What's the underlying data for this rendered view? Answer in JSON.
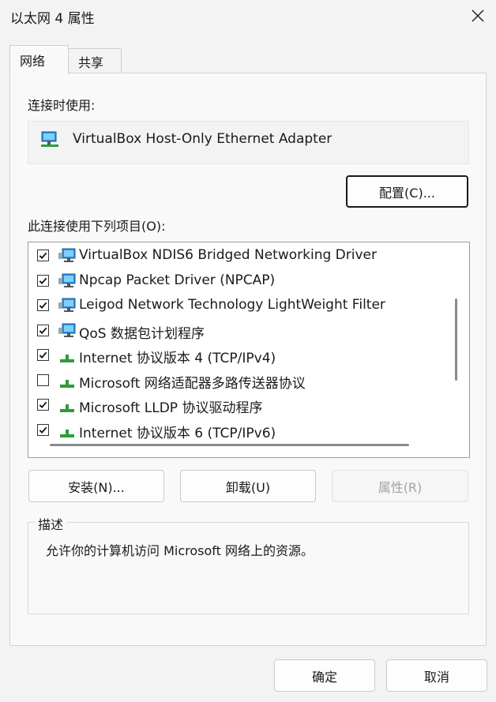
{
  "window": {
    "title": "以太网 4 属性"
  },
  "tabs": [
    {
      "label": "网络",
      "active": true
    },
    {
      "label": "共享",
      "active": false
    }
  ],
  "connect_using": {
    "label": "连接时使用:",
    "adapter": "VirtualBox Host-Only Ethernet Adapter",
    "icon": "network-adapter-icon"
  },
  "configure_button": "配置(C)...",
  "items_section": {
    "label": "此连接使用下列项目(O):",
    "items": [
      {
        "label": "VirtualBox NDIS6 Bridged Networking Driver",
        "checked": true,
        "icon": "network-service-icon"
      },
      {
        "label": "Npcap Packet Driver (NPCAP)",
        "checked": true,
        "icon": "network-service-icon"
      },
      {
        "label": "Leigod Network Technology LightWeight Filter",
        "checked": true,
        "icon": "network-service-icon"
      },
      {
        "label": "QoS 数据包计划程序",
        "checked": true,
        "icon": "network-service-icon"
      },
      {
        "label": "Internet 协议版本 4 (TCP/IPv4)",
        "checked": true,
        "icon": "protocol-icon"
      },
      {
        "label": "Microsoft 网络适配器多路传送器协议",
        "checked": false,
        "icon": "protocol-icon"
      },
      {
        "label": "Microsoft LLDP 协议驱动程序",
        "checked": true,
        "icon": "protocol-icon"
      },
      {
        "label": "Internet 协议版本 6 (TCP/IPv6)",
        "checked": true,
        "icon": "protocol-icon"
      }
    ]
  },
  "buttons": {
    "install": "安装(N)...",
    "uninstall": "卸载(U)",
    "properties": "属性(R)",
    "ok": "确定",
    "cancel": "取消"
  },
  "description": {
    "legend": "描述",
    "text": "允许你的计算机访问 Microsoft 网络上的资源。"
  },
  "colors": {
    "accent": "#0067c0",
    "protocol_green": "#2e9c3a",
    "monitor_blue": "#2f8fd6"
  }
}
